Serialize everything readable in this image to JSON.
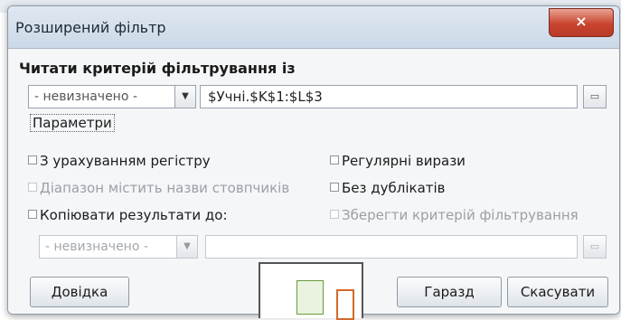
{
  "dialog": {
    "title": "Розширений фільтр",
    "close_symbol": "×"
  },
  "criteria": {
    "heading": "Читати критерій фільтрування із",
    "range_combo_value": "- невизначено -",
    "range_value": "$Учні.$K$1:$L$3"
  },
  "options": {
    "label": "Параметри",
    "case_sensitive": "З урахуванням регістру",
    "header_row": "Діапазон містить назви стовпчиків",
    "copy_results": "Копіювати результати до:",
    "regex": "Регулярні вирази",
    "no_duplicates": "Без дублікатів",
    "keep_criteria": "Зберегти критерій фільтрування",
    "copy_combo_value": "- невизначено -",
    "copy_target_value": ""
  },
  "buttons": {
    "help": "Довідка",
    "ok": "Гаразд",
    "cancel": "Скасувати"
  },
  "icons": {
    "dropdown": "chevron-down-icon",
    "shrink": "shrink-dialog-icon"
  }
}
